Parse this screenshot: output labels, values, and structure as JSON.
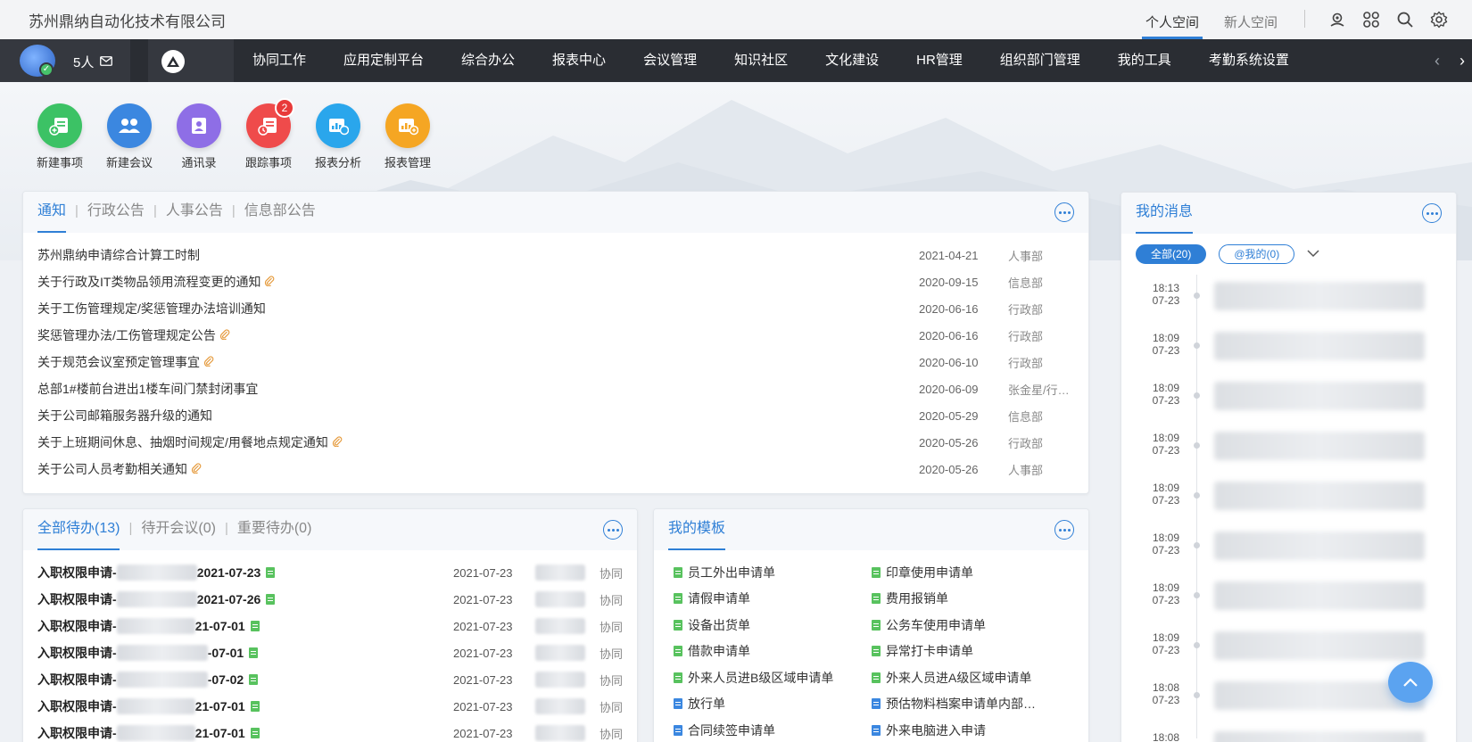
{
  "header": {
    "company": "苏州鼎纳自动化技术有限公司",
    "space_tabs": [
      "个人空间",
      "新人空间"
    ]
  },
  "navbar": {
    "user_count": "5人",
    "items": [
      "协同工作",
      "应用定制平台",
      "综合办公",
      "报表中心",
      "会议管理",
      "知识社区",
      "文化建设",
      "HR管理",
      "组织部门管理",
      "我的工具",
      "考勤系统设置"
    ]
  },
  "apps": [
    {
      "label": "新建事项",
      "color": "#3cc265",
      "icon": "new-item-icon"
    },
    {
      "label": "新建会议",
      "color": "#3b87e0",
      "icon": "meeting-icon"
    },
    {
      "label": "通讯录",
      "color": "#8e6ee6",
      "icon": "contacts-icon"
    },
    {
      "label": "跟踪事项",
      "color": "#ef4b4b",
      "icon": "track-icon",
      "badge": "2"
    },
    {
      "label": "报表分析",
      "color": "#2aa6ec",
      "icon": "report-analysis-icon"
    },
    {
      "label": "报表管理",
      "color": "#f5a623",
      "icon": "report-manage-icon"
    }
  ],
  "notices": {
    "tabs": [
      "通知",
      "行政公告",
      "人事公告",
      "信息部公告"
    ],
    "rows": [
      {
        "title": "苏州鼎纳申请综合计算工时制",
        "date": "2021-04-21",
        "dept": "人事部",
        "attach": false
      },
      {
        "title": "关于行政及IT类物品领用流程变更的通知",
        "date": "2020-09-15",
        "dept": "信息部",
        "attach": true
      },
      {
        "title": "关于工伤管理规定/奖惩管理办法培训通知",
        "date": "2020-06-16",
        "dept": "行政部",
        "attach": false
      },
      {
        "title": "奖惩管理办法/工伤管理规定公告",
        "date": "2020-06-16",
        "dept": "行政部",
        "attach": true
      },
      {
        "title": "关于规范会议室预定管理事宜",
        "date": "2020-06-10",
        "dept": "行政部",
        "attach": true
      },
      {
        "title": "总部1#楼前台进出1楼车间门禁封闭事宜",
        "date": "2020-06-09",
        "dept": "张金星/行…",
        "attach": false
      },
      {
        "title": "关于公司邮箱服务器升级的通知",
        "date": "2020-05-29",
        "dept": "信息部",
        "attach": false
      },
      {
        "title": "关于上班期间休息、抽烟时间规定/用餐地点规定通知",
        "date": "2020-05-26",
        "dept": "行政部",
        "attach": true
      },
      {
        "title": "关于公司人员考勤相关通知",
        "date": "2020-05-26",
        "dept": "人事部",
        "attach": true
      }
    ]
  },
  "todos": {
    "tabs": [
      "全部待办(13)",
      "待开会议(0)",
      "重要待办(0)"
    ],
    "rows": [
      {
        "prefix": "入职权限申请-",
        "suffix": "2021-07-23",
        "date": "2021-07-23",
        "type": "协同"
      },
      {
        "prefix": "入职权限申请-",
        "suffix": "2021-07-26",
        "date": "2021-07-23",
        "type": "协同"
      },
      {
        "prefix": "入职权限申请-",
        "suffix": "21-07-01",
        "date": "2021-07-23",
        "type": "协同"
      },
      {
        "prefix": "入职权限申请-",
        "suffix": "-07-01",
        "date": "2021-07-23",
        "type": "协同"
      },
      {
        "prefix": "入职权限申请-",
        "suffix": "-07-02",
        "date": "2021-07-23",
        "type": "协同"
      },
      {
        "prefix": "入职权限申请-",
        "suffix": "21-07-01",
        "date": "2021-07-23",
        "type": "协同"
      },
      {
        "prefix": "入职权限申请-",
        "suffix": "21-07-01",
        "date": "2021-07-23",
        "type": "协同"
      }
    ]
  },
  "templates": {
    "title": "我的模板",
    "items": [
      {
        "label": "员工外出申请单",
        "color": "green"
      },
      {
        "label": "印章使用申请单",
        "color": "green"
      },
      {
        "label": "请假申请单",
        "color": "green"
      },
      {
        "label": "费用报销单",
        "color": "green"
      },
      {
        "label": "设备出货单",
        "color": "green"
      },
      {
        "label": "公务车使用申请单",
        "color": "green"
      },
      {
        "label": "借款申请单",
        "color": "green"
      },
      {
        "label": "异常打卡申请单",
        "color": "green"
      },
      {
        "label": "外来人员进B级区域申请单",
        "color": "green"
      },
      {
        "label": "外来人员进A级区域申请单",
        "color": "green"
      },
      {
        "label": "放行单",
        "color": "blue"
      },
      {
        "label": "预估物料档案申请单内部…",
        "color": "blue"
      },
      {
        "label": "合同续签申请单",
        "color": "blue"
      },
      {
        "label": "外来电脑进入申请",
        "color": "blue"
      }
    ]
  },
  "messages": {
    "title": "我的消息",
    "filter_all": "全部(20)",
    "filter_at": "@我的(0)",
    "items": [
      {
        "time": "18:13",
        "date": "07-23"
      },
      {
        "time": "18:09",
        "date": "07-23"
      },
      {
        "time": "18:09",
        "date": "07-23"
      },
      {
        "time": "18:09",
        "date": "07-23"
      },
      {
        "time": "18:09",
        "date": "07-23"
      },
      {
        "time": "18:09",
        "date": "07-23"
      },
      {
        "time": "18:09",
        "date": "07-23"
      },
      {
        "time": "18:09",
        "date": "07-23"
      },
      {
        "time": "18:08",
        "date": "07-23"
      },
      {
        "time": "18:08",
        "date": "07-23"
      }
    ]
  },
  "colors": {
    "accent": "#2f7fd6",
    "nav_bg": "#2a2d33"
  }
}
